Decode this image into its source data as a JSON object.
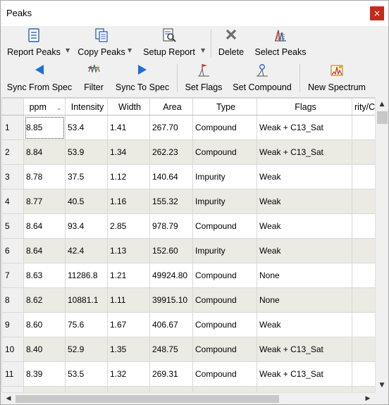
{
  "window": {
    "title": "Peaks",
    "close_glyph": "×"
  },
  "toolbar_row1": [
    {
      "name": "report-peaks-button",
      "label": "Report Peaks",
      "icon": "report-icon",
      "dropdown": true
    },
    {
      "name": "copy-peaks-button",
      "label": "Copy Peaks",
      "icon": "copy-icon",
      "dropdown": true
    },
    {
      "name": "setup-report-button",
      "label": "Setup Report",
      "icon": "setup-report-icon",
      "dropdown": true
    },
    {
      "name": "delete-button",
      "label": "Delete",
      "icon": "delete-x-icon",
      "dropdown": false
    },
    {
      "name": "select-peaks-button",
      "label": "Select Peaks",
      "icon": "select-peaks-icon",
      "dropdown": false
    }
  ],
  "toolbar_row2": [
    {
      "name": "sync-from-spec-button",
      "label": "Sync From Spec",
      "icon": "arrow-left-icon"
    },
    {
      "name": "filter-button",
      "label": "Filter",
      "icon": "filter-icon"
    },
    {
      "name": "sync-to-spec-button",
      "label": "Sync To Spec",
      "icon": "arrow-right-icon"
    },
    {
      "name": "set-flags-button",
      "label": "Set Flags",
      "icon": "flag-icon"
    },
    {
      "name": "set-compound-button",
      "label": "Set Compound",
      "icon": "compound-icon"
    },
    {
      "name": "new-spectrum-button",
      "label": "New Spectrum",
      "icon": "spectrum-icon"
    }
  ],
  "dropdown_glyph": "▼",
  "sort_glyph": "⌄",
  "columns": [
    "ppm",
    "Intensity",
    "Width",
    "Area",
    "Type",
    "Flags",
    "rity/C"
  ],
  "rows": [
    {
      "n": "1",
      "ppm": "8.85",
      "intensity": "53.4",
      "width": "1.41",
      "area": "267.70",
      "type": "Compound",
      "flags": "Weak + C13_Sat"
    },
    {
      "n": "2",
      "ppm": "8.84",
      "intensity": "53.9",
      "width": "1.34",
      "area": "262.23",
      "type": "Compound",
      "flags": "Weak + C13_Sat"
    },
    {
      "n": "3",
      "ppm": "8.78",
      "intensity": "37.5",
      "width": "1.12",
      "area": "140.64",
      "type": "Impurity",
      "flags": "Weak"
    },
    {
      "n": "4",
      "ppm": "8.77",
      "intensity": "40.5",
      "width": "1.16",
      "area": "155.32",
      "type": "Impurity",
      "flags": "Weak"
    },
    {
      "n": "5",
      "ppm": "8.64",
      "intensity": "93.4",
      "width": "2.85",
      "area": "978.79",
      "type": "Compound",
      "flags": "Weak"
    },
    {
      "n": "6",
      "ppm": "8.64",
      "intensity": "42.4",
      "width": "1.13",
      "area": "152.60",
      "type": "Impurity",
      "flags": "Weak"
    },
    {
      "n": "7",
      "ppm": "8.63",
      "intensity": "11286.8",
      "width": "1.21",
      "area": "49924.80",
      "type": "Compound",
      "flags": "None"
    },
    {
      "n": "8",
      "ppm": "8.62",
      "intensity": "10881.1",
      "width": "1.11",
      "area": "39915.10",
      "type": "Compound",
      "flags": "None"
    },
    {
      "n": "9",
      "ppm": "8.60",
      "intensity": "75.6",
      "width": "1.67",
      "area": "406.67",
      "type": "Compound",
      "flags": "Weak"
    },
    {
      "n": "10",
      "ppm": "8.40",
      "intensity": "52.9",
      "width": "1.35",
      "area": "248.75",
      "type": "Compound",
      "flags": "Weak + C13_Sat"
    },
    {
      "n": "11",
      "ppm": "8.39",
      "intensity": "53.5",
      "width": "1.32",
      "area": "269.31",
      "type": "Compound",
      "flags": "Weak + C13_Sat"
    },
    {
      "n": "",
      "ppm": "",
      "intensity": "",
      "width": "",
      "area": "",
      "type": "",
      "flags": ""
    }
  ],
  "scroll_glyphs": {
    "up": "▲",
    "down": "▼",
    "left": "◀",
    "right": "▶"
  }
}
